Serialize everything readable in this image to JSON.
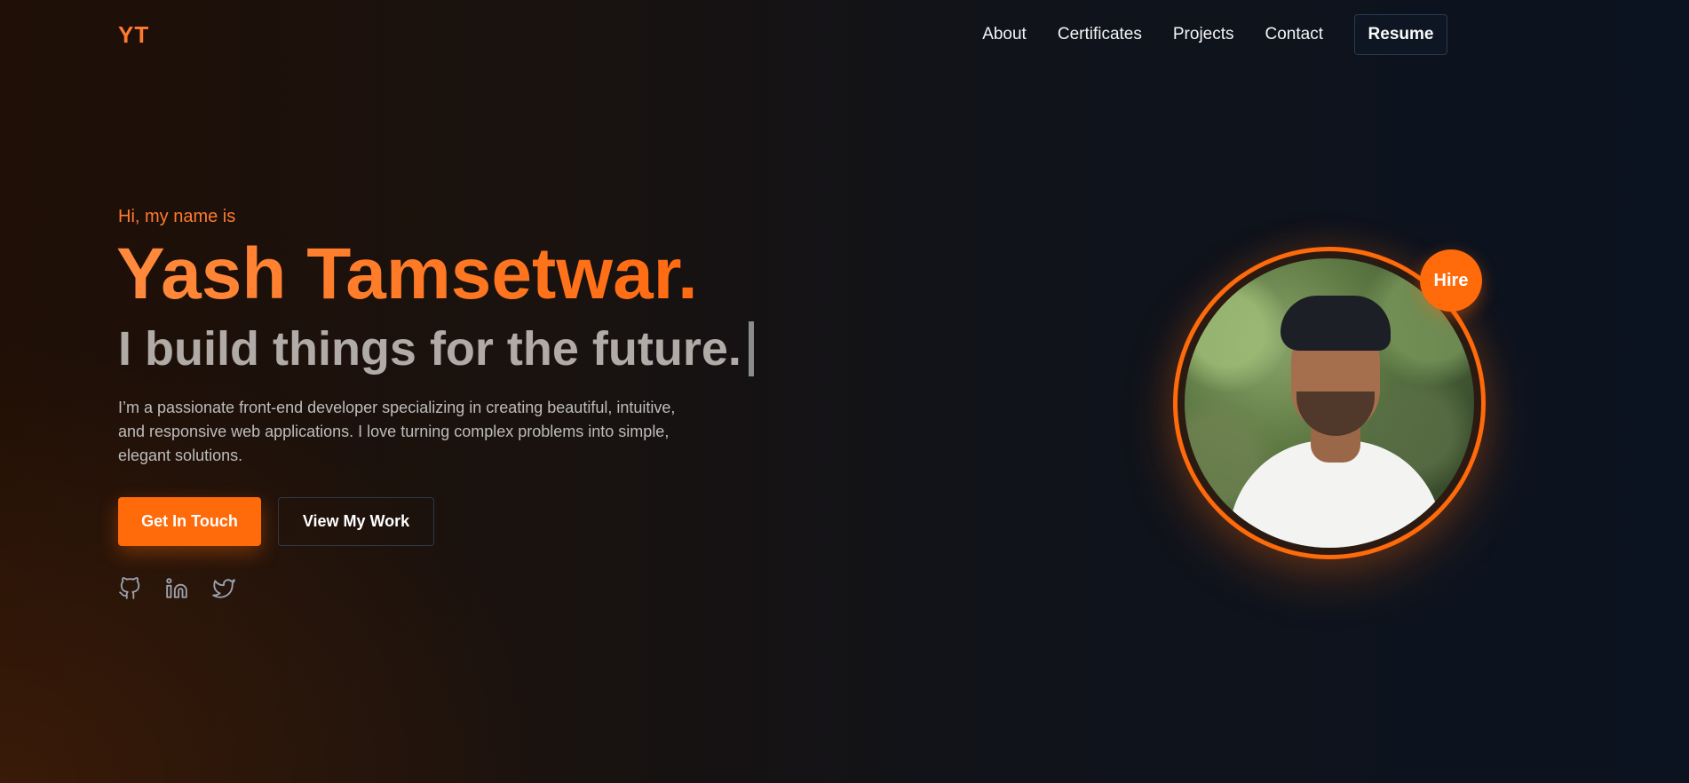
{
  "nav": {
    "logo": "YT",
    "links": [
      {
        "label": "About"
      },
      {
        "label": "Certificates"
      },
      {
        "label": "Projects"
      },
      {
        "label": "Contact"
      }
    ],
    "resume_label": "Resume"
  },
  "hero": {
    "greeting": "Hi, my name is",
    "name": "Yash Tamsetwar.",
    "tagline": "I build things for the future.",
    "bio": "I’m a passionate front-end developer specializing in creating beautiful, intuitive, and responsive web applications. I love turning complex problems into simple, elegant solutions.",
    "primary_button": "Get In Touch",
    "secondary_button": "View My Work",
    "socials": [
      {
        "icon": "github-icon"
      },
      {
        "icon": "linkedin-icon"
      },
      {
        "icon": "twitter-icon"
      }
    ],
    "hire_badge": "Hire"
  },
  "colors": {
    "accent": "#ff6a0a",
    "accent_light": "#ff7a2f",
    "background_dark": "#0b1320",
    "tagline": "#b1aba8"
  }
}
